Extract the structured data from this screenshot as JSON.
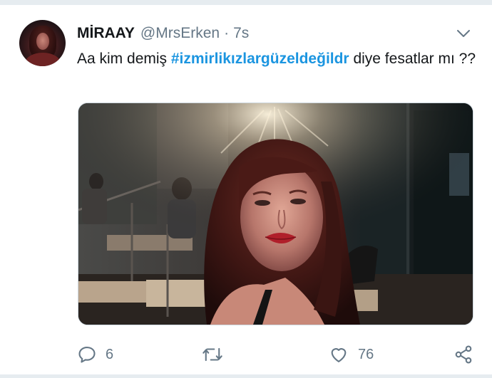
{
  "tweet": {
    "display_name": "MİRAAY",
    "handle": "@MrsErken",
    "separator": "·",
    "time": "7s",
    "text_before": "Aa kim demiş ",
    "hashtag": "#izmirlikızlargüzeldeğildr",
    "text_after": " diye fesatlar mı ??",
    "image_alt": "Selfie of a woman with long red hair and red lipstick in a dimly lit cafe"
  },
  "actions": {
    "reply": {
      "icon": "reply-icon",
      "count": "6"
    },
    "retweet": {
      "icon": "retweet-icon",
      "count": ""
    },
    "like": {
      "icon": "heart-icon",
      "count": "76"
    },
    "share": {
      "icon": "share-icon"
    }
  },
  "colors": {
    "accent": "#1b95e0",
    "text": "#14171a",
    "secondary": "#657786",
    "background": "#e6ecf0"
  }
}
